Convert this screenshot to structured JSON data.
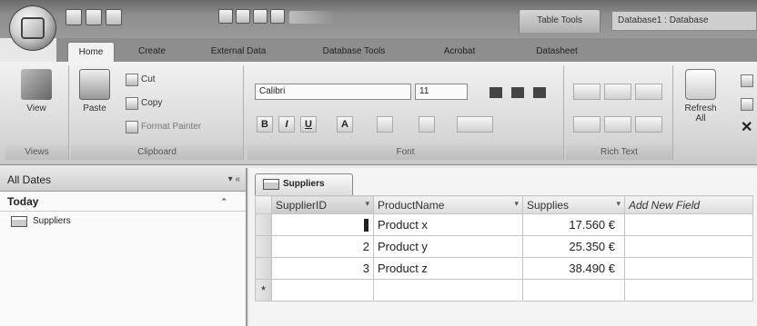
{
  "window": {
    "context_tab": "Table Tools",
    "title": "Database1 : Database"
  },
  "office_button": {
    "logo": ""
  },
  "ribbon_tabs": [
    "Home",
    "Create",
    "External Data",
    "Database Tools",
    "Acrobat",
    "Datasheet"
  ],
  "ribbon": {
    "views": {
      "view_label": "View",
      "group_label": "Views"
    },
    "clipboard": {
      "paste_label": "Paste",
      "cut_label": "Cut",
      "copy_label": "Copy",
      "format_painter_label": "Format Painter",
      "group_label": "Clipboard"
    },
    "font": {
      "font_name": "Calibri",
      "font_size": "11",
      "bold": "B",
      "italic": "I",
      "underline": "U",
      "font_color": "A",
      "group_label": "Font"
    },
    "rich_text": {
      "group_label": "Rich Text"
    },
    "records": {
      "refresh_label": "Refresh All"
    }
  },
  "nav_pane": {
    "header": "All Dates",
    "group": "Today",
    "items": [
      "Suppliers"
    ]
  },
  "document": {
    "tab_label": "Suppliers",
    "columns": [
      "SupplierID",
      "ProductName",
      "Supplies",
      "Add New Field"
    ],
    "rows": [
      {
        "id": "",
        "name": "Product x",
        "supplies": "17.560 €"
      },
      {
        "id": "2",
        "name": "Product y",
        "supplies": "25.350 €"
      },
      {
        "id": "3",
        "name": "Product z",
        "supplies": "38.490 €"
      }
    ],
    "new_row_marker": "*"
  }
}
